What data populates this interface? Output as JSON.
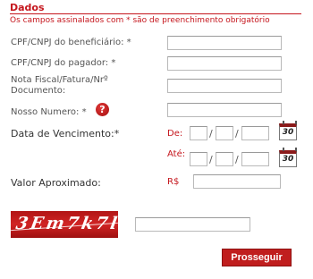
{
  "section": {
    "title": "Dados",
    "required_note": "Os campos assinalados com * são de preenchimento obrigatório"
  },
  "fields": {
    "cpf_beneficiario": {
      "label": "CPF/CNPJ do beneficiário:",
      "required": "*",
      "value": ""
    },
    "cpf_pagador": {
      "label": "CPF/CNPJ do pagador:",
      "required": "*",
      "value": ""
    },
    "nota_fiscal": {
      "label_line1": "Nota Fiscal/Fatura/Nrº",
      "label_line2": "Documento:",
      "value": ""
    },
    "nosso_numero": {
      "label": "Nosso Numero:",
      "required": "*",
      "help": "?",
      "value": ""
    },
    "vencimento": {
      "label": "Data de Vencimento:*",
      "de_label": "De:",
      "ate_label": "Até:",
      "separator": "/",
      "calendar_day": "30"
    },
    "valor": {
      "label": "Valor Aproximado:",
      "currency": "R$",
      "value": ""
    }
  },
  "captcha": {
    "text": "3Em7k7l",
    "input_value": ""
  },
  "actions": {
    "submit_label": "Prosseguir"
  },
  "colors": {
    "accent": "#c5161d",
    "button": "#c01e1e"
  }
}
